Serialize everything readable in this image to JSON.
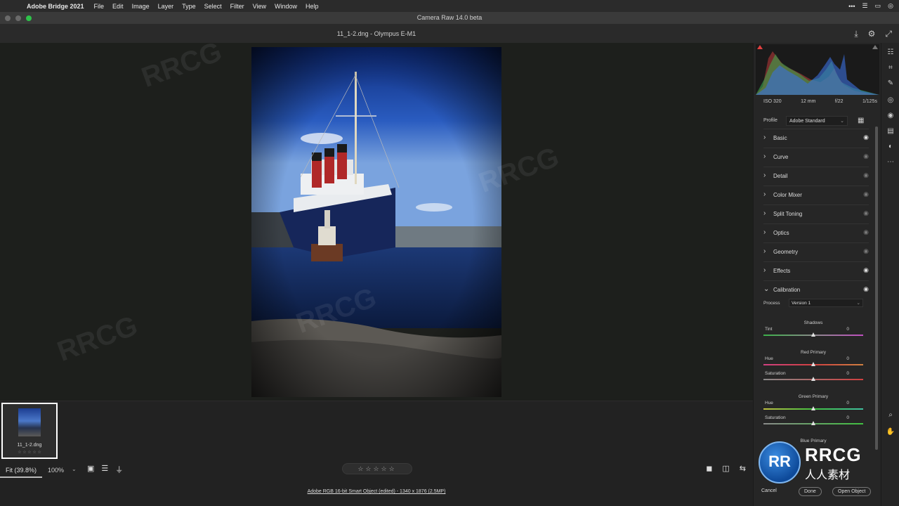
{
  "menubar": {
    "app_name": "Adobe Bridge 2021",
    "items": [
      "File",
      "Edit",
      "Image",
      "Layer",
      "Type",
      "Select",
      "Filter",
      "View",
      "Window",
      "Help"
    ]
  },
  "window": {
    "title": "Camera Raw 14.0 beta"
  },
  "file": {
    "name": "11_1-2.dng  -  Olympus E-M1"
  },
  "exif": {
    "iso": "ISO 320",
    "focal": "12 mm",
    "aperture": "f/22",
    "shutter": "1/125s"
  },
  "profile": {
    "label": "Profile",
    "value": "Adobe Standard"
  },
  "sections": [
    {
      "label": "Basic",
      "eye_on": true
    },
    {
      "label": "Curve",
      "eye_on": false
    },
    {
      "label": "Detail",
      "eye_on": false
    },
    {
      "label": "Color Mixer",
      "eye_on": false
    },
    {
      "label": "Split Toning",
      "eye_on": false
    },
    {
      "label": "Optics",
      "eye_on": false
    },
    {
      "label": "Geometry",
      "eye_on": false
    },
    {
      "label": "Effects",
      "eye_on": true
    },
    {
      "label": "Calibration",
      "eye_on": true,
      "expanded": true
    }
  ],
  "calibration": {
    "process_label": "Process",
    "process_value": "Version 1",
    "shadows_label": "Shadows",
    "tint": {
      "label": "Tint",
      "value": "0"
    },
    "red_label": "Red Primary",
    "red_hue": {
      "label": "Hue",
      "value": "0"
    },
    "red_sat": {
      "label": "Saturation",
      "value": "0"
    },
    "green_label": "Green Primary",
    "green_hue": {
      "label": "Hue",
      "value": "0"
    },
    "green_sat": {
      "label": "Saturation",
      "value": "0"
    },
    "blue_label": "Blue Primary"
  },
  "filmstrip": {
    "thumb_name": "11_1-2.dng",
    "thumb_stars": "☆ ☆ ☆ ☆ ☆"
  },
  "bottombar": {
    "fit": "Fit (39.8%)",
    "zoom": "100%",
    "rating": "☆☆☆☆☆",
    "info_link": "Adobe RGB 16-bit Smart Object (edited) - 1340 x 1876 (2.5MP)"
  },
  "buttons": {
    "cancel": "Cancel",
    "done": "Done",
    "open_object": "Open Object"
  },
  "logo": {
    "brand": "RRCG",
    "sub": "人人素材"
  },
  "colors": {
    "accent": "#e0e0e0",
    "panel_bg": "#262626",
    "canvas_bg": "#1d1f1c"
  }
}
